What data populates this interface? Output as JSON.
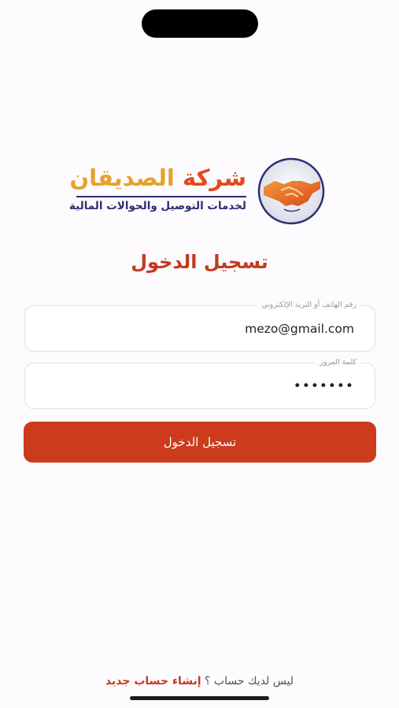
{
  "brand": {
    "name_part1": "شركة",
    "name_part2": "الصديقان",
    "tagline": "لخدمات التوصيل والحوالات المالية",
    "logo_icon": "handshake-icon",
    "colors": {
      "orange": "#e24a1f",
      "gold": "#e7a12b",
      "navy": "#2d2e73"
    }
  },
  "login": {
    "heading": "تسجيل الدخول",
    "email_label": "رقم الهاتف أو البريد الإلكتروني",
    "email_value": "mezo@gmail.com",
    "password_label": "كلمة المرور",
    "password_value": "mezo123",
    "submit_label": "تسجيل الدخول"
  },
  "signup": {
    "question": "ليس لديك حساب ؟",
    "link_label": "إنشاء حساب جديد"
  },
  "colors": {
    "accent": "#cb3b1c",
    "heading": "#c33a1f"
  }
}
